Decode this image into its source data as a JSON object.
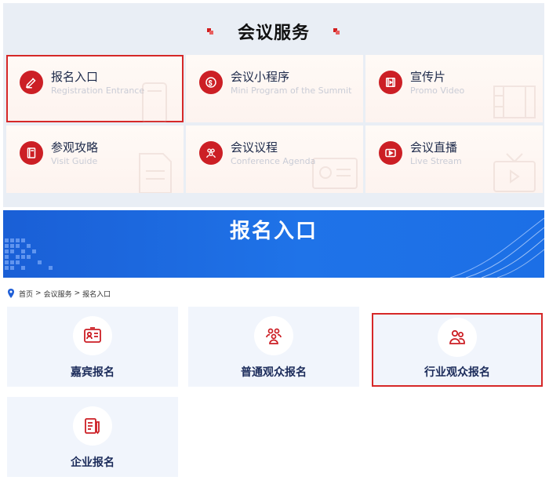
{
  "services": {
    "title": "会议服务",
    "items": [
      {
        "title": "报名入口",
        "subtitle": "Registration Entrance",
        "icon": "pen-icon",
        "selected": true
      },
      {
        "title": "会议小程序",
        "subtitle": "Mini Program of the Summit",
        "icon": "mini-program-icon",
        "selected": false
      },
      {
        "title": "宣传片",
        "subtitle": "Promo Video",
        "icon": "film-icon",
        "selected": false
      },
      {
        "title": "参观攻略",
        "subtitle": "Visit Guide",
        "icon": "book-icon",
        "selected": false
      },
      {
        "title": "会议议程",
        "subtitle": "Conference Agenda",
        "icon": "people-icon",
        "selected": false
      },
      {
        "title": "会议直播",
        "subtitle": "Live Stream",
        "icon": "play-icon",
        "selected": false
      }
    ]
  },
  "banner": {
    "title": "报名入口"
  },
  "breadcrumb": {
    "items": [
      "首页",
      "会议服务",
      "报名入口"
    ],
    "separator": ">"
  },
  "registration": {
    "items": [
      {
        "label": "嘉宾报名",
        "icon": "id-card-icon",
        "selected": false
      },
      {
        "label": "普通观众报名",
        "icon": "audience-icon",
        "selected": false
      },
      {
        "label": "行业观众报名",
        "icon": "users-icon",
        "selected": true
      },
      {
        "label": "企业报名",
        "icon": "form-icon",
        "selected": false
      }
    ]
  },
  "colors": {
    "accent_red": "#cc1f25",
    "banner_blue": "#1f73e8",
    "card_bg": "#f1f5fc",
    "label_navy": "#1b2b5a"
  }
}
